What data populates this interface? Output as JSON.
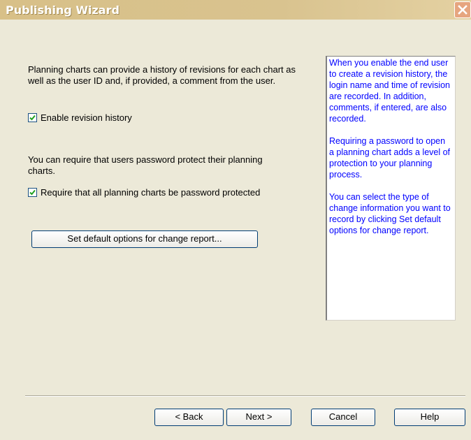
{
  "window": {
    "title": "Publishing Wizard",
    "close_icon": "close-icon"
  },
  "revision": {
    "description": "Planning charts can provide a history of revisions for each chart as well as the user ID and, if provided, a comment from the user.",
    "checkbox_label": "Enable revision history",
    "checked": true
  },
  "password": {
    "description": "You can require that users password protect their planning charts.",
    "checkbox_label": "Require that all planning charts be password protected",
    "checked": true
  },
  "change_report_button": "Set default options for change report...",
  "info_panel": {
    "paragraphs": [
      "When you enable the end user to create a revision history, the login name and time of revision are recorded. In addition, comments, if entered, are also recorded.",
      "Requiring a password to open a planning chart adds a level of protection to your planning process.",
      "You can select the type of change information you want to record by clicking Set default options for change report."
    ]
  },
  "buttons": {
    "back": "< Back",
    "next": "Next >",
    "cancel": "Cancel",
    "help": "Help"
  },
  "colors": {
    "title_bar": "#d9c38f",
    "dialog_bg": "#ece9d8",
    "info_text": "#0000ff"
  }
}
